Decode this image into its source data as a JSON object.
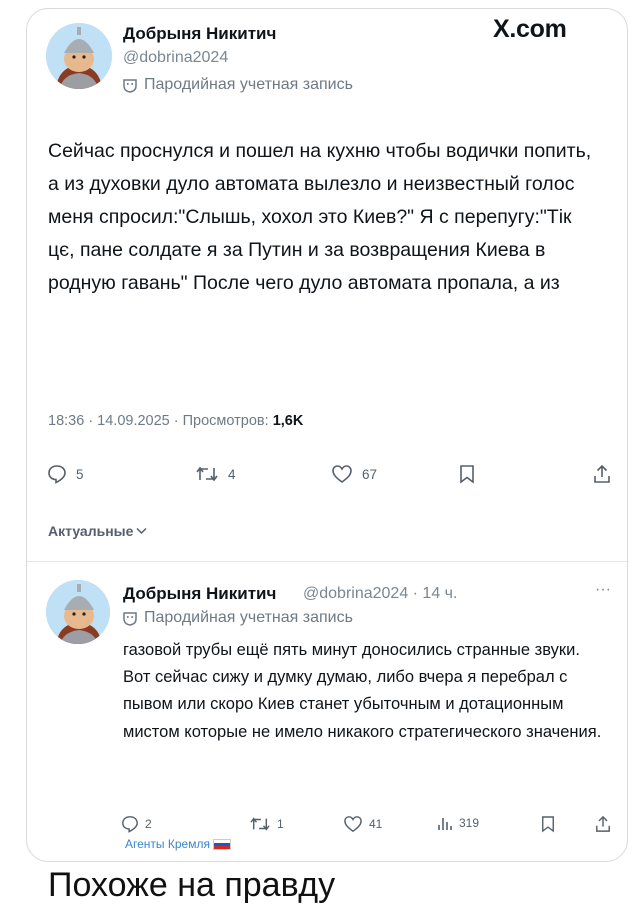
{
  "main_tweet": {
    "author_name": "Добрыня Никитич",
    "handle": "@dobrina2024",
    "parody_label": "Пародийная учетная запись",
    "site_label": "X.com",
    "text": "Сейчас проснулся и пошел на кухню чтобы водички попить, а из духовки дуло автомата вылезло и неизвестный голос меня спросил:\"Слышь, хохол это Киев?\" Я с перепугу:\"Тiк цє, пане солдате я за Путин и за возвращения Киева в родную гавань\" После чего дуло автомата пропала, а из",
    "time_date": "18:36 · 14.09.2025 · Просмотров: ",
    "views": "1,6K",
    "actions": {
      "replies": "5",
      "reposts": "4",
      "likes": "67"
    }
  },
  "replies_tab": {
    "label": "Актуальные"
  },
  "reply_tweet": {
    "author_name": "Добрыня Никитич",
    "handle_time": "@dobrina2024 · 14 ч.",
    "parody_label": "Пародийная учетная запись",
    "more_label": "···",
    "text": "газовой трубы ещё пять минут доносились странные звуки.\nВот сейчас сижу и думку думаю, либо вчера я перебрал с пывом или скоро Киев станет убыточным и дотационным мистом которые не имело никакого стратегического значения.",
    "actions": {
      "replies": "2",
      "reposts": "1",
      "likes": "41",
      "views": "319"
    }
  },
  "watermark": "Агенты Кремля",
  "caption": "Похоже на правду"
}
